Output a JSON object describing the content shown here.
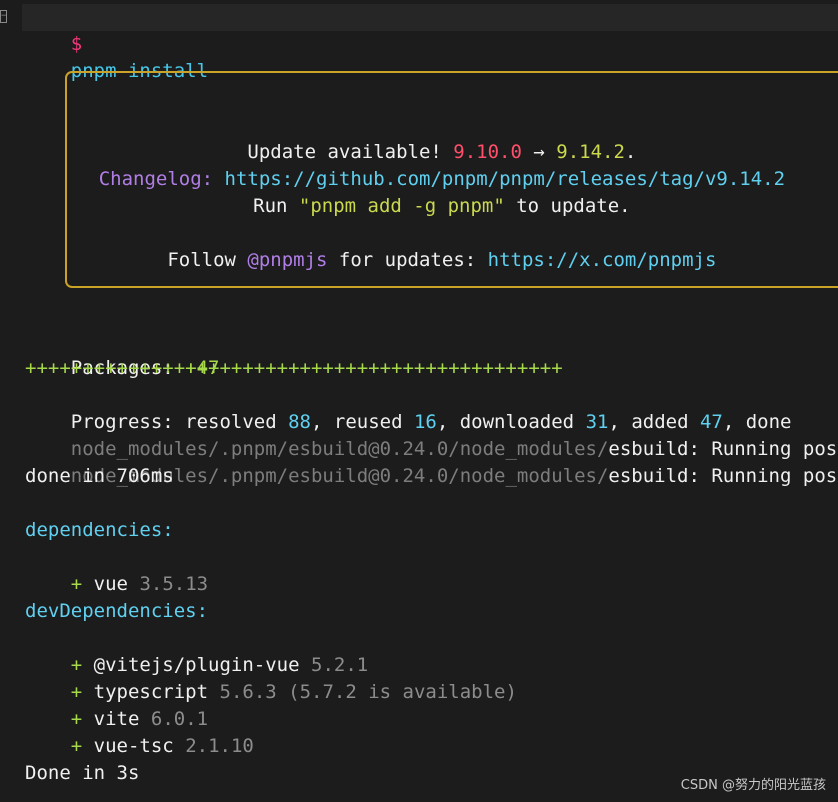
{
  "terminal": {
    "prompt_symbol": "$",
    "command": "pnpm install",
    "gutter_icon": "collapse-toggle-icon"
  },
  "update_box": {
    "line1": {
      "text1": "Update available! ",
      "from_version": "9.10.0",
      "arrow": " → ",
      "to_version": "9.14.2",
      "period": "."
    },
    "line2": {
      "label": "Changelog: ",
      "url": "https://github.com/pnpm/pnpm/releases/tag/v9.14.2"
    },
    "line3": {
      "run": "Run ",
      "quoted_command": "\"pnpm add -g pnpm\"",
      "rest": " to update."
    },
    "line4": {
      "follow": "Follow ",
      "handle": "@pnpmjs",
      "middle": " for updates: ",
      "url": "https://x.com/pnpmjs"
    },
    "border_color": "#c9a227"
  },
  "install": {
    "packages_label": "Packages:",
    "packages_value": " +47",
    "plus_bar": "+++++++++++++++++++++++++++++++++++++++++++++++",
    "progress": {
      "label": "Progress:",
      "resolved_label": " resolved ",
      "resolved": "88",
      "reused_label": ", reused ",
      "reused": "16",
      "downloaded_label": ", downloaded ",
      "downloaded": "31",
      "added_label": ", added ",
      "added": "47",
      "done": ", done"
    },
    "postinstall_lines": [
      {
        "path": "node_modules/.pnpm/esbuild@0.24.0/node_modules/",
        "pkg": "esbuild",
        "status": ": Running postin"
      },
      {
        "path": "node_modules/.pnpm/esbuild@0.24.0/node_modules/",
        "pkg": "esbuild",
        "status": ": Running postin"
      }
    ],
    "done_time": "done in 706ms"
  },
  "dependencies": {
    "heading": "dependencies:",
    "items": [
      {
        "name": "vue",
        "version": "3.5.13"
      }
    ]
  },
  "dev_dependencies": {
    "heading": "devDependencies:",
    "items": [
      {
        "name": "@vitejs/plugin-vue",
        "version": "5.2.1"
      },
      {
        "name": "typescript",
        "version": "5.6.3 (5.7.2 is available)"
      },
      {
        "name": "vite",
        "version": "6.0.1"
      },
      {
        "name": "vue-tsc",
        "version": "2.1.10"
      }
    ]
  },
  "footer": {
    "done": "Done in 3s"
  },
  "watermark": "CSDN @努力的阳光蓝孩"
}
